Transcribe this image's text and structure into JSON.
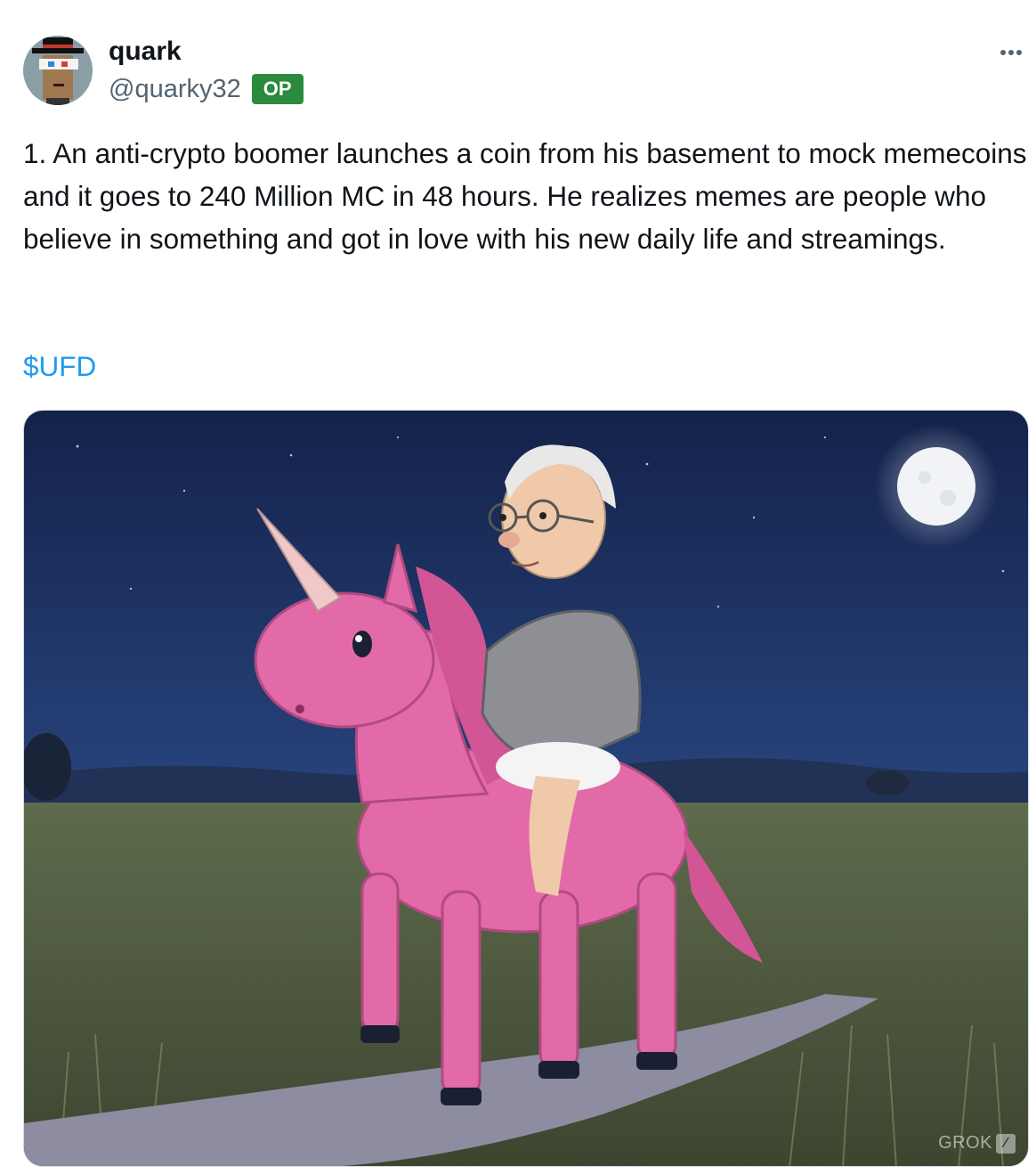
{
  "tweet": {
    "author": {
      "display_name": "quark",
      "handle": "@quarky32",
      "badge": "OP",
      "badge_color": "#2b8a3e"
    },
    "text": "1. An anti-crypto boomer launches a coin from his basement to mock memecoins and it goes to 240 Million MC in 48 hours. He realizes memes are people who believe in something and got in love with his new daily life and streamings.",
    "cashtag": "$UFD",
    "more_icon": "more-horizontal-icon",
    "media": {
      "description_icon": "generated-image",
      "watermark": "GROK"
    }
  },
  "colors": {
    "link": "#1d9bf0",
    "secondary_text": "#536471",
    "primary_text": "#0f1419"
  }
}
